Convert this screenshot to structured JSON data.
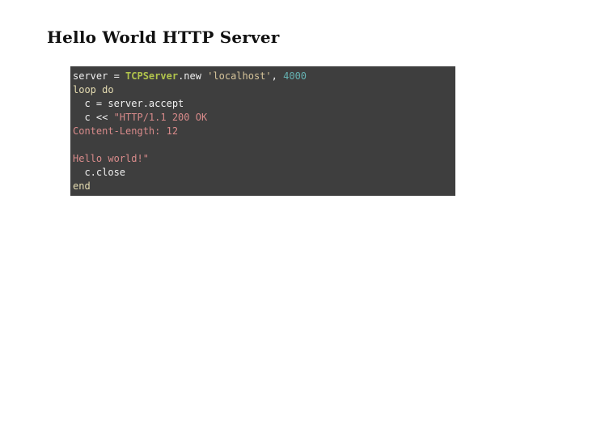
{
  "page": {
    "title": "Hello World HTTP Server"
  },
  "code_block": {
    "language": "ruby",
    "background": "#3e3e3e",
    "colors": {
      "plain": "#f0f0f0",
      "keyword": "#e6ddb2",
      "class": "#b1c44c",
      "string_single": "#d6c49a",
      "string_double": "#d98b8b",
      "number": "#65b1b1"
    },
    "lines": [
      [
        [
          "server = ",
          "plain"
        ],
        [
          "TCPServer",
          "class"
        ],
        [
          ".new ",
          "plain"
        ],
        [
          "'localhost'",
          "string_single"
        ],
        [
          ", ",
          "plain"
        ],
        [
          "4000",
          "number"
        ]
      ],
      [
        [
          "loop do",
          "keyword"
        ]
      ],
      [
        [
          "  c = server.accept",
          "plain"
        ]
      ],
      [
        [
          "  c << ",
          "plain"
        ],
        [
          "\"HTTP/1.1 200 OK",
          "string_double"
        ]
      ],
      [
        [
          "Content-Length: 12",
          "string_double"
        ]
      ],
      [],
      [
        [
          "Hello world!\"",
          "string_double"
        ]
      ],
      [
        [
          "  c.close",
          "plain"
        ]
      ],
      [
        [
          "end",
          "keyword"
        ]
      ]
    ]
  }
}
